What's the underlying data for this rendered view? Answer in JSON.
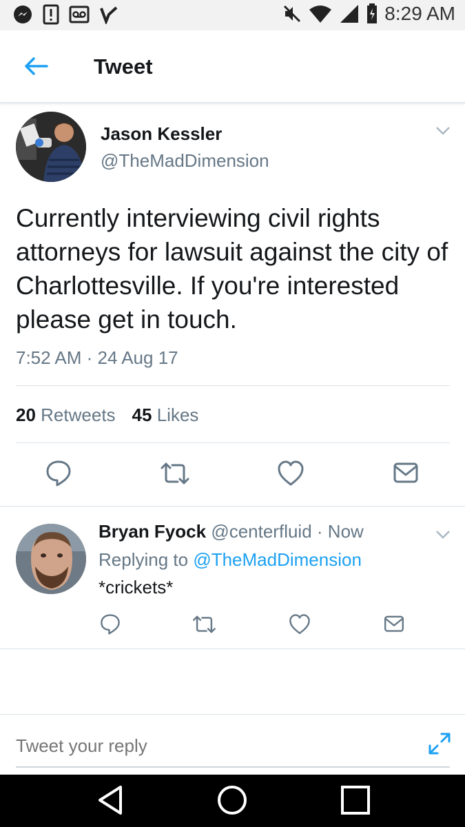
{
  "status_bar": {
    "time": "8:29 AM",
    "left_icons": [
      "messenger-icon",
      "alert-icon",
      "voicemail-icon",
      "check-icon"
    ],
    "right_icons": [
      "mute-icon",
      "wifi-icon",
      "signal-icon",
      "battery-icon"
    ]
  },
  "header": {
    "title": "Tweet"
  },
  "tweet": {
    "author_name": "Jason Kessler",
    "author_handle": "@TheMadDimension",
    "text": "Currently interviewing civil rights attorneys for lawsuit against the city of Charlottesville. If you're interested please get in touch.",
    "timestamp": "7:52 AM · 24 Aug 17",
    "retweets_count": "20",
    "retweets_label": "Retweets",
    "likes_count": "45",
    "likes_label": "Likes"
  },
  "reply": {
    "author_name": "Bryan Fyock",
    "author_handle": "@centerfluid",
    "time": "· Now",
    "replying_prefix": "Replying to",
    "replying_handle": "@TheMadDimension",
    "text": "*crickets*"
  },
  "compose": {
    "placeholder": "Tweet your reply"
  },
  "colors": {
    "accent": "#1da1f2",
    "secondary_text": "#657786",
    "primary_text": "#14171a"
  }
}
